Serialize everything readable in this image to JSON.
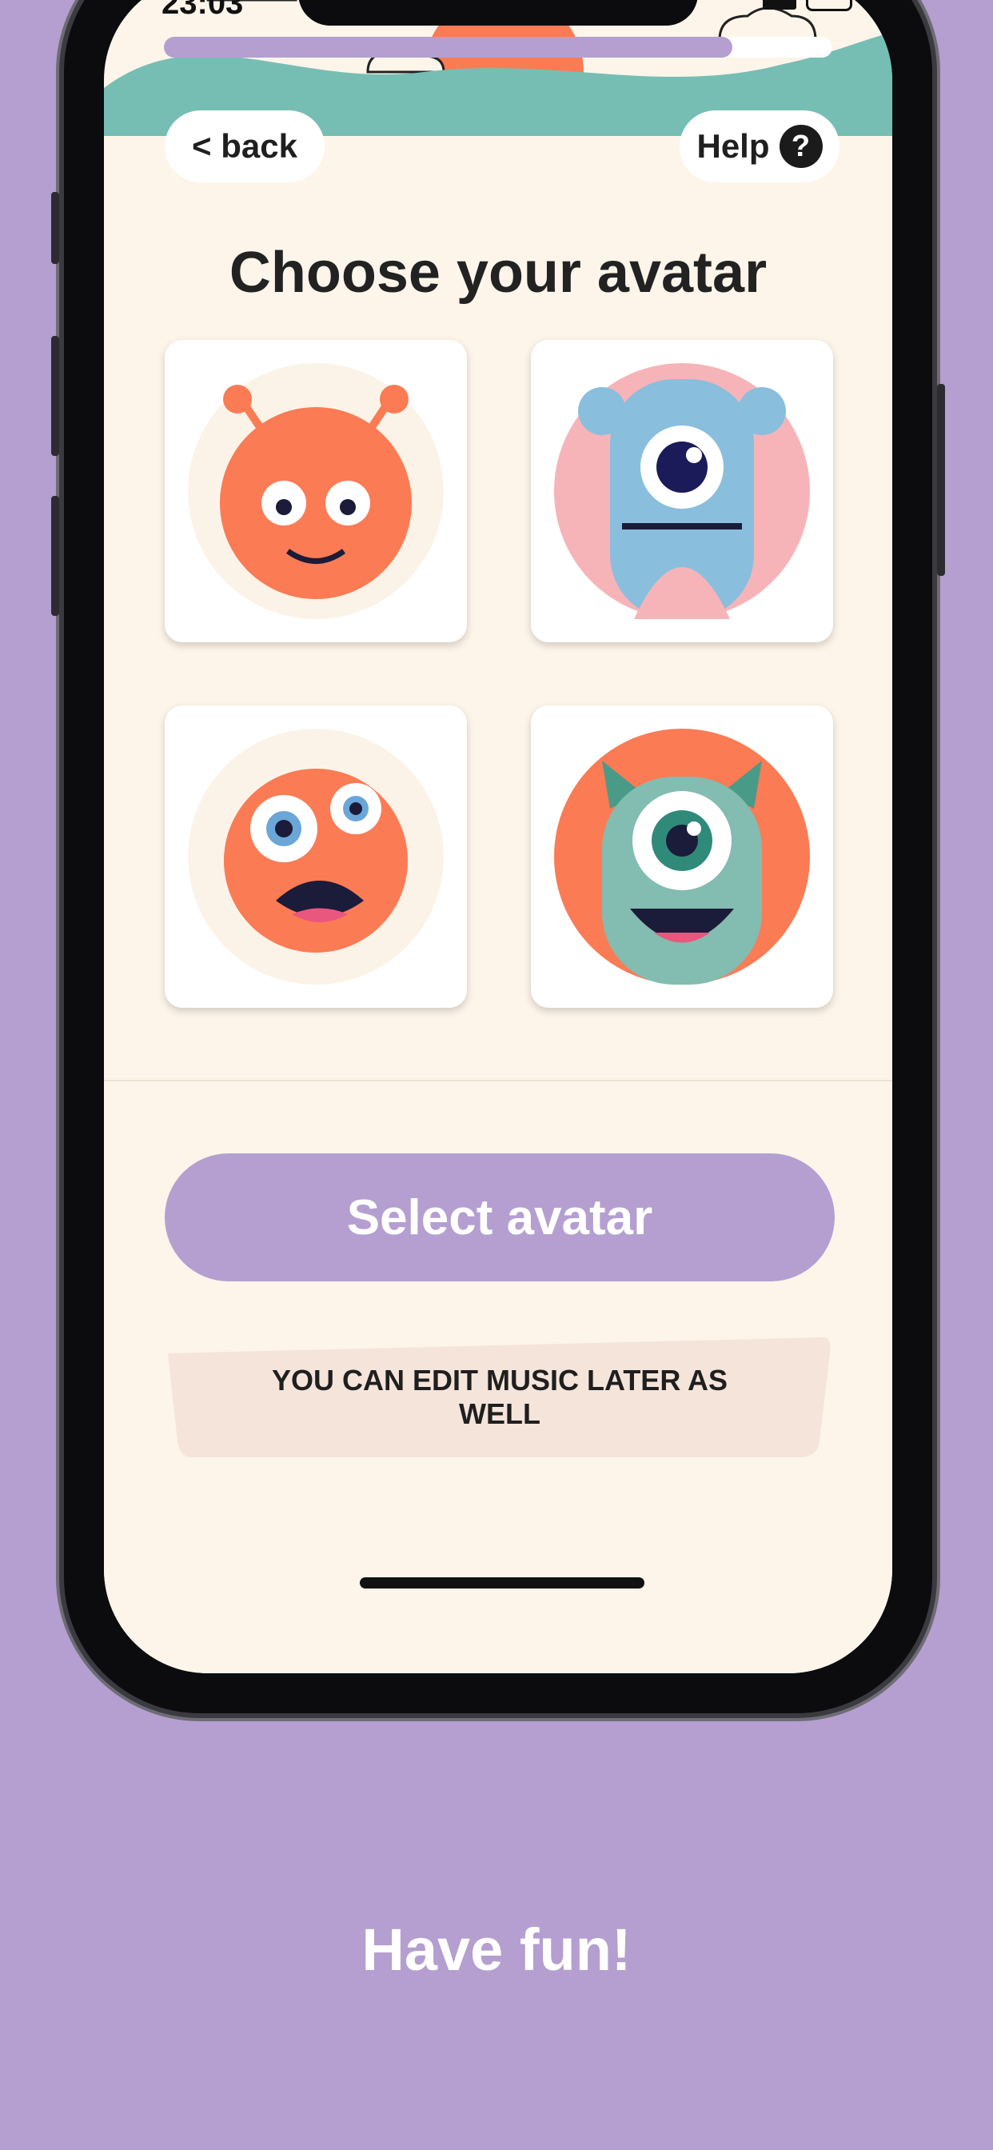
{
  "status_bar": {
    "time": "23:03"
  },
  "header": {
    "back_label": "< back",
    "help_label": "Help",
    "help_icon": "?",
    "progress": 0.85
  },
  "page_title": "Choose your avatar",
  "avatars": [
    {
      "name": "orange fuzzy monster with antennae"
    },
    {
      "name": "blue one-eyed monster"
    },
    {
      "name": "orange shaggy monster"
    },
    {
      "name": "teal one-eyed horned monster"
    }
  ],
  "select_button_label": "Select avatar",
  "note_text": "YOU CAN EDIT MUSIC LATER AS WELL",
  "tagline": "Have fun!",
  "colors": {
    "background": "#b49fd0",
    "screen": "#fdf5ea",
    "accent": "#b49fd0",
    "hill": "#76beb4",
    "sun": "#fb7b54",
    "note_bg": "#f5e4da"
  }
}
